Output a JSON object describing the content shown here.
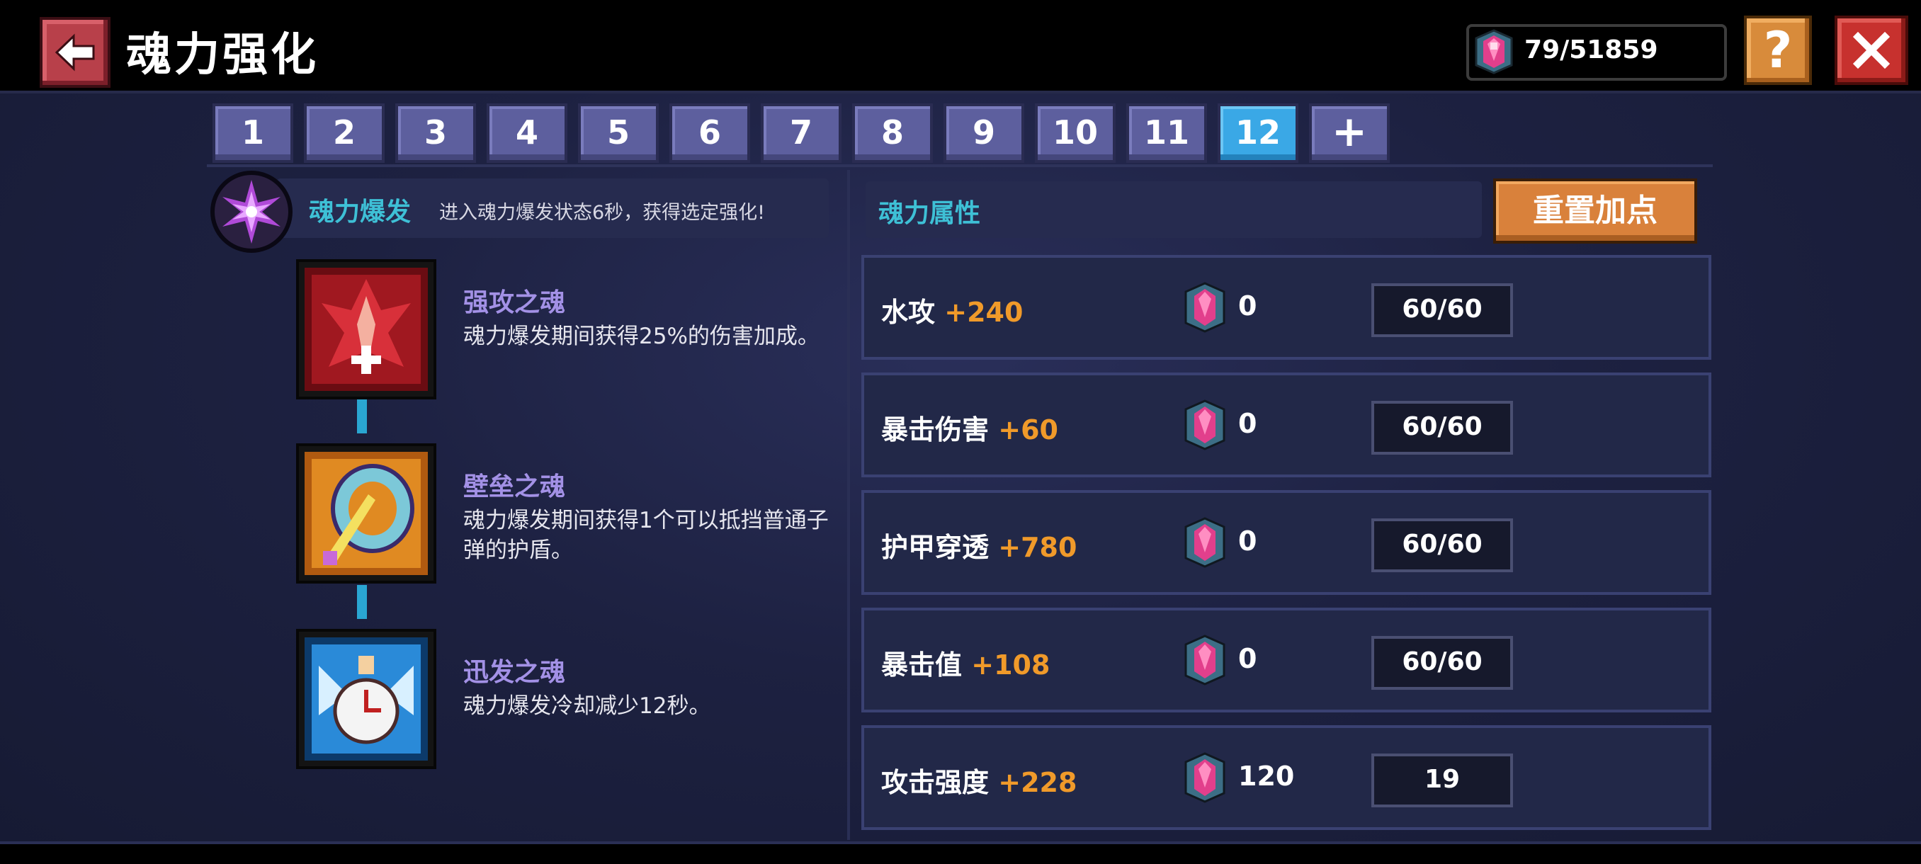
{
  "header": {
    "title": "魂力强化",
    "currency_value": "79/51859",
    "back_icon": "arrow-left-icon",
    "help_label": "?",
    "close_icon": "close-icon"
  },
  "tabs": [
    "1",
    "2",
    "3",
    "4",
    "5",
    "6",
    "7",
    "8",
    "9",
    "10",
    "11",
    "12",
    "+"
  ],
  "active_tab": "12",
  "burst": {
    "title": "魂力爆发",
    "description": "进入魂力爆发状态6秒，获得选定强化!"
  },
  "souls": [
    {
      "name": "强攻之魂",
      "description": "魂力爆发期间获得25%的伤害加成。"
    },
    {
      "name": "壁垒之魂",
      "description": "魂力爆发期间获得1个可以抵挡普通子弹的护盾。"
    },
    {
      "name": "迅发之魂",
      "description": "魂力爆发冷却减少12秒。"
    }
  ],
  "attributes_panel": {
    "title": "魂力属性",
    "reset_label": "重置加点"
  },
  "attributes": [
    {
      "name": "水攻",
      "bonus": "+240",
      "cost": "0",
      "progress": "60/60"
    },
    {
      "name": "暴击伤害",
      "bonus": "+60",
      "cost": "0",
      "progress": "60/60"
    },
    {
      "name": "护甲穿透",
      "bonus": "+780",
      "cost": "0",
      "progress": "60/60"
    },
    {
      "name": "暴击值",
      "bonus": "+108",
      "cost": "0",
      "progress": "60/60"
    },
    {
      "name": "攻击强度",
      "bonus": "+228",
      "cost": "120",
      "progress": "19"
    }
  ],
  "colors": {
    "accent_cyan": "#3ec0d6",
    "bonus_orange": "#f09a2a",
    "soul_name_purple": "#a391e6",
    "tab_active": "#3aa8e6",
    "tab_inactive": "#5d5f9e"
  }
}
